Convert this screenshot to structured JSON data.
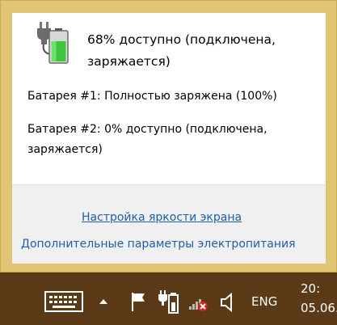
{
  "flyout": {
    "summary": "68% доступно (подключена, заряжается)",
    "battery1": "Батарея #1: Полностью заряжена (100%)",
    "battery2": "Батарея #2: 0% доступно (подключена, заряжается)",
    "brightness_link": "Настройка яркости экрана",
    "power_link": "Дополнительные параметры электропитания"
  },
  "taskbar": {
    "language": "ENG",
    "time": "20:",
    "date": "05.06."
  },
  "icons": {
    "battery": "battery-charging-icon",
    "keyboard": "touch-keyboard-icon",
    "chevron": "show-hidden-icons-chevron-icon",
    "flag": "action-center-flag-icon",
    "tray_battery": "tray-battery-plug-icon",
    "network": "network-disconnected-icon",
    "speaker": "speaker-volume-icon"
  },
  "colors": {
    "flyout_border": "#e2c572",
    "link": "#1f5ea8",
    "taskbar": "#5b3a18",
    "battery_fill": "#3cc63c",
    "network_error": "#d32020"
  }
}
